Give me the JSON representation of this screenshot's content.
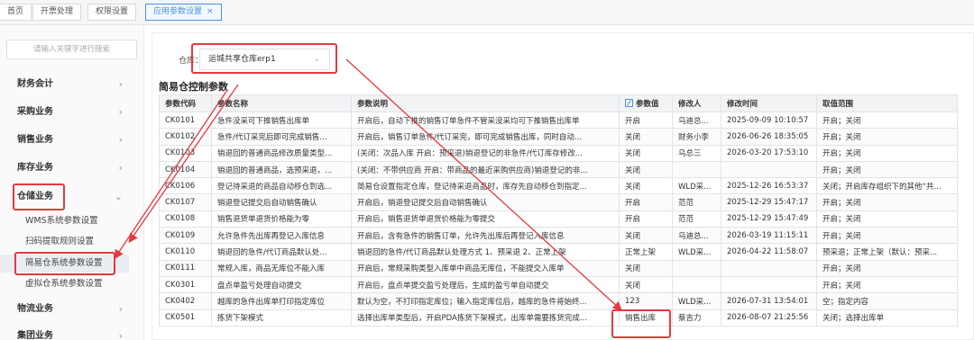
{
  "tabs": [
    {
      "label": "首页"
    },
    {
      "label": "开票处理"
    },
    {
      "label": "权限设置"
    },
    {
      "label": "应用参数设置",
      "close": "×"
    }
  ],
  "sidebar": {
    "search_placeholder": "请输入关键字进行搜索",
    "items": [
      {
        "label": "财务会计"
      },
      {
        "label": "采购业务"
      },
      {
        "label": "销售业务"
      },
      {
        "label": "库存业务"
      },
      {
        "label": "仓储业务"
      },
      {
        "label": "物流业务"
      },
      {
        "label": "集团业务"
      }
    ],
    "sub_items": [
      {
        "label": "WMS系统参数设置"
      },
      {
        "label": "扫码提取规则设置"
      },
      {
        "label": "简易仓系统参数设置"
      },
      {
        "label": "虚拟仓系统参数设置"
      }
    ],
    "chevron_right": "›",
    "chevron_down": "⌄"
  },
  "warehouse": {
    "label": "仓库：",
    "value": "运城共享仓库erp1",
    "chevron": "⌄"
  },
  "section_title": "简易仓控制参数",
  "table": {
    "headers": [
      "参数代码",
      "参数名称",
      "参数说明",
      "参数值",
      "修改人",
      "修改时间",
      "取值范围"
    ],
    "rows": [
      [
        "CK0101",
        "急件没采可下推销售出库单",
        "开启后，自动下推的销售订单急件不管采没采均可下推销售出库单",
        "开启",
        "乌迪总...",
        "2025-09-09 10:10:57",
        "开启；关闭"
      ],
      [
        "CK0102",
        "急件/代订采完后即可完成销售...",
        "开启后，销售订单急件/代订采完，即可完成销售出库，同时自动...",
        "关闭",
        "财务小李",
        "2026-06-26 18:35:05",
        "开启；关闭"
      ],
      [
        "CK0103",
        "销退回的普通商品修改质量类型...",
        "(关闭：次品入库 开启：预采退)销退登记的非急件/代订库存修改...",
        "关闭",
        "乌总三",
        "2026-03-20 17:53:10",
        "开启；关闭"
      ],
      [
        "CK0104",
        "销退回的普通商品，选预采退，...",
        "(关闭：不带供应商 开启：带商品的最近采购供应商)销退登记的非...",
        "关闭",
        "",
        "",
        "开启；关闭"
      ],
      [
        "CK0106",
        "登记待采退的商品自动移仓到选...",
        "简易仓设置指定仓库，登记待采退商品时，库存先自动移仓到指定...",
        "关闭",
        "WLD采...",
        "2025-12-26 16:53:37",
        "关闭；开启库存组织下的其他“共..."
      ],
      [
        "CK0107",
        "销退登记提交后自动销售确认",
        "开启后，销退登记提交后自动销售确认",
        "开启",
        "范范",
        "2025-12-29 15:47:17",
        "开启；关闭"
      ],
      [
        "CK0108",
        "销售退货单退货价格能为零",
        "开启后，销售退货单退货价格能为零提交",
        "开启",
        "范范",
        "2025-12-29 15:47:49",
        "开启；关闭"
      ],
      [
        "CK0109",
        "允许急件先出库再登记入库信息",
        "开启后，含有急件的销售订单，允许先出库后再登记入库信息",
        "关闭",
        "乌迪总...",
        "2026-03-19 11:15:11",
        "开启；关闭"
      ],
      [
        "CK0110",
        "销退回的急件/代订商品默认处...",
        "销退回的急件/代订商品默认处理方式 1、预采退 2、正常上架",
        "正常上架",
        "WLD采...",
        "2026-04-22 11:58:07",
        "预采退；正常上架（默认：预采..."
      ],
      [
        "CK0111",
        "常规入库，商品无库位不能入库",
        "开启后，常规采购类型入库单中商品无库位，不能提交入库单",
        "关闭",
        "",
        "",
        "开启；关闭"
      ],
      [
        "CK0301",
        "盘点单盈亏处理自动提交",
        "开启后，盘点单提交盈亏处理后，生成的盈亏单自动提交",
        "关闭",
        "",
        "",
        "开启；关闭"
      ],
      [
        "CK0402",
        "越库的急件出库单打印指定库位",
        "默认为空，不打印指定库位；输入指定库位后，越库的急件将始终...",
        "123",
        "WLD采...",
        "2026-07-31 13:54:01",
        "空；指定内容"
      ],
      [
        "CK0501",
        "拣货下架模式",
        "选择出库单类型后，开启PDA拣货下架模式，出库单需要拣货完成...",
        "销售出库",
        "蔡吉力",
        "2026-08-07 21:25:56",
        "关闭；选择出库单"
      ]
    ]
  },
  "colors": {
    "accent": "#4a90e2",
    "annotation_red": "#e5393f"
  },
  "icons": [
    "close-icon",
    "chevron-right-icon",
    "chevron-down-icon",
    "edit-icon"
  ]
}
